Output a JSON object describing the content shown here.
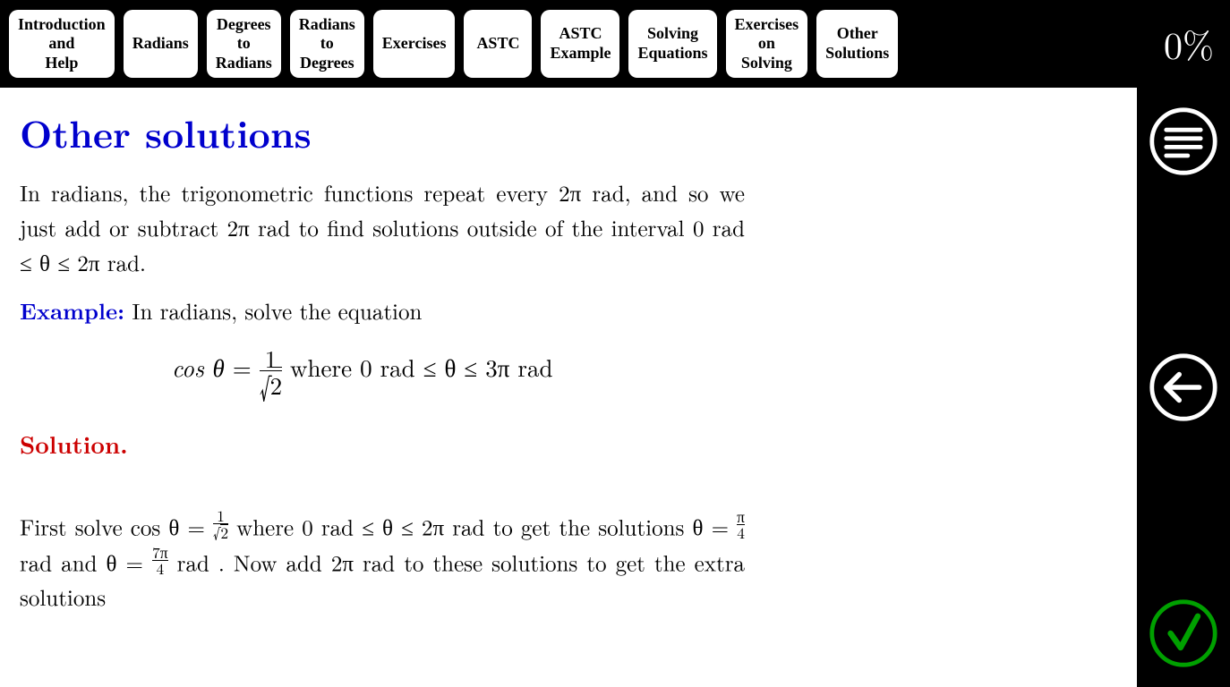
{
  "tabs": [
    "Introduction\nand\nHelp",
    "Radians",
    "Degrees\nto\nRadians",
    "Radians\nto\nDegrees",
    "Exercises",
    "ASTC",
    "ASTC\nExample",
    "Solving\nEquations",
    "Exercises\non\nSolving",
    "Other\nSolutions"
  ],
  "progress": "0%",
  "heading": "Other solutions",
  "intro": "In radians, the trigonometric functions repeat every 2π rad, and so we just add or subtract 2π rad to find solutions outside of the interval 0 rad  ≤  θ  ≤  2π rad.",
  "example_label": "Example:",
  "example_text": " In radians, solve the equation",
  "eq": {
    "lhs": "cos θ",
    "eq": "  =  ",
    "frac_num": "1",
    "frac_den_surd": "√",
    "frac_den_rad": "2",
    "where": "    where    0 rad  ≤  θ  ≤  3π rad"
  },
  "solution_label": "Solution.",
  "body1a": "First solve cos θ  =  ",
  "sfrac1_num": "1",
  "sfrac1_den_surd": "√",
  "sfrac1_den_rad": "2",
  "body1b": " where 0 rad ≤ θ ≤ 2π rad to get the solutions θ  =  ",
  "sfrac2_num": "π",
  "sfrac2_den": "4",
  "body1c": " rad and θ  =  ",
  "sfrac3_num": "7π",
  "sfrac3_den": "4",
  "body1d": " rad .  Now add 2π rad to these solutions to get the extra solutions"
}
